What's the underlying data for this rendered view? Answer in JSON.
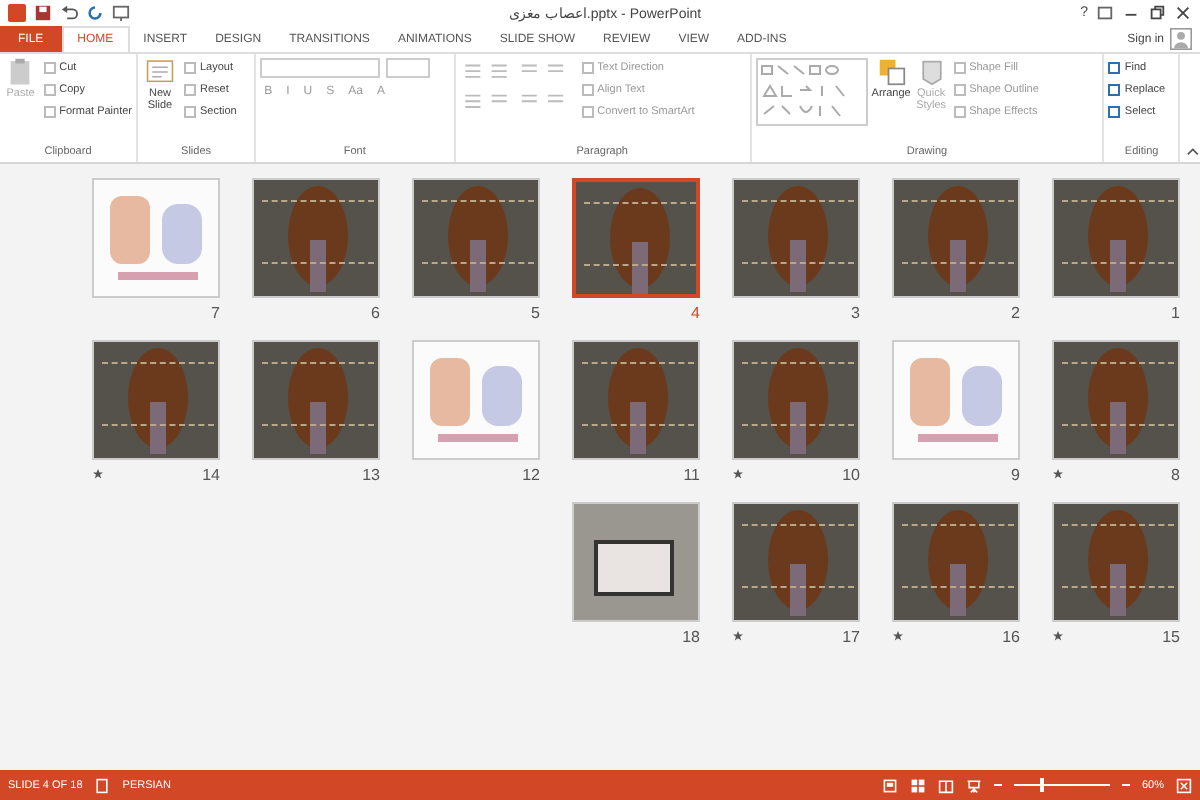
{
  "window": {
    "title": "اعصاب مغزی.pptx - PowerPoint",
    "help": "?",
    "sign_in": "Sign in"
  },
  "tabs": [
    {
      "label": "FILE",
      "kind": "file",
      "selected": false
    },
    {
      "label": "HOME",
      "kind": "tab",
      "selected": true
    },
    {
      "label": "INSERT",
      "kind": "tab",
      "selected": false
    },
    {
      "label": "DESIGN",
      "kind": "tab",
      "selected": false
    },
    {
      "label": "TRANSITIONS",
      "kind": "tab",
      "selected": false
    },
    {
      "label": "ANIMATIONS",
      "kind": "tab",
      "selected": false
    },
    {
      "label": "SLIDE SHOW",
      "kind": "tab",
      "selected": false
    },
    {
      "label": "REVIEW",
      "kind": "tab",
      "selected": false
    },
    {
      "label": "VIEW",
      "kind": "tab",
      "selected": false
    },
    {
      "label": "ADD-INS",
      "kind": "tab",
      "selected": false
    }
  ],
  "ribbon": {
    "clipboard": {
      "label": "Clipboard",
      "paste": "Paste",
      "items": [
        "Cut",
        "Copy",
        "Format Painter"
      ]
    },
    "slides": {
      "label": "Slides",
      "new_slide": "New Slide",
      "items": [
        "Layout",
        "Reset",
        "Section"
      ]
    },
    "font": {
      "label": "Font",
      "buttons": [
        "B",
        "I",
        "U",
        "S",
        "Aa",
        "A"
      ]
    },
    "paragraph": {
      "label": "Paragraph",
      "items": [
        "Text Direction",
        "Align Text",
        "Convert to SmartArt"
      ]
    },
    "drawing": {
      "label": "Drawing",
      "arrange": "Arrange",
      "quick_styles": "Quick Styles",
      "items": [
        "Shape Fill",
        "Shape Outline",
        "Shape Effects"
      ]
    },
    "editing": {
      "label": "Editing",
      "items": [
        "Find",
        "Replace",
        "Select"
      ]
    }
  },
  "slide_rows": [
    {
      "slides": [
        {
          "number": "7",
          "kind": "light",
          "selected": false,
          "animated": false
        },
        {
          "number": "6",
          "kind": "dark",
          "selected": false,
          "animated": false
        },
        {
          "number": "5",
          "kind": "dark",
          "selected": false,
          "animated": false
        },
        {
          "number": "4",
          "kind": "dark",
          "selected": true,
          "animated": false
        },
        {
          "number": "3",
          "kind": "dark",
          "selected": false,
          "animated": false
        },
        {
          "number": "2",
          "kind": "dark",
          "selected": false,
          "animated": false
        },
        {
          "number": "1",
          "kind": "dark",
          "selected": false,
          "animated": false
        }
      ]
    },
    {
      "slides": [
        {
          "number": "14",
          "kind": "dark",
          "selected": false,
          "animated": true
        },
        {
          "number": "13",
          "kind": "dark",
          "selected": false,
          "animated": false
        },
        {
          "number": "12",
          "kind": "light",
          "selected": false,
          "animated": false
        },
        {
          "number": "11",
          "kind": "dark",
          "selected": false,
          "animated": false
        },
        {
          "number": "10",
          "kind": "dark",
          "selected": false,
          "animated": true
        },
        {
          "number": "9",
          "kind": "light",
          "selected": false,
          "animated": false
        },
        {
          "number": "8",
          "kind": "dark",
          "selected": false,
          "animated": true
        }
      ]
    },
    {
      "slides": [
        {
          "number": "18",
          "kind": "photo",
          "selected": false,
          "animated": false
        },
        {
          "number": "17",
          "kind": "dark",
          "selected": false,
          "animated": true
        },
        {
          "number": "16",
          "kind": "dark",
          "selected": false,
          "animated": true
        },
        {
          "number": "15",
          "kind": "dark",
          "selected": false,
          "animated": true
        }
      ]
    }
  ],
  "status_bar": {
    "slide": "SLIDE 4 OF 18",
    "language": "PERSIAN",
    "zoom": {
      "level": 0.3,
      "reading": "60%"
    }
  }
}
